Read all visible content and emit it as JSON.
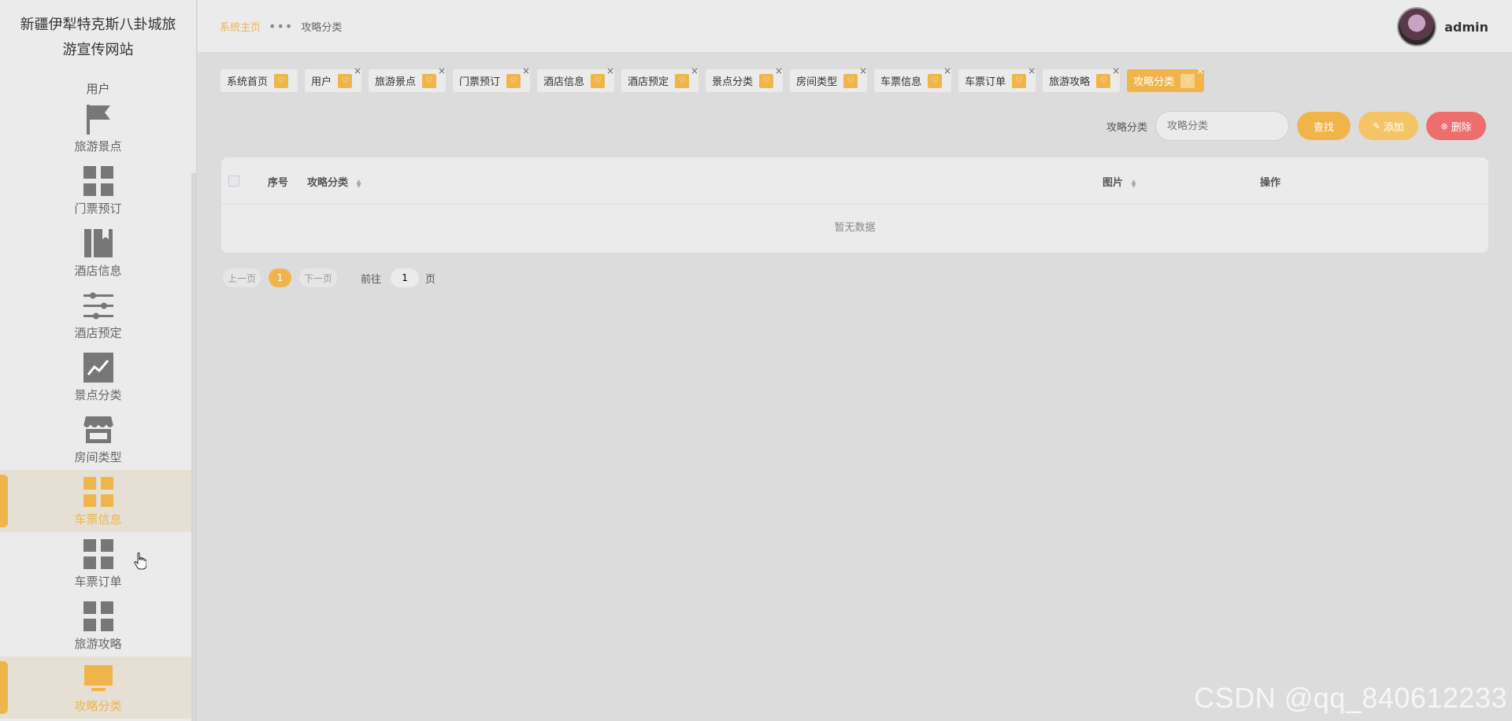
{
  "site": {
    "title": "新疆伊犁特克斯八卦城旅游宣传网站"
  },
  "sidebar": {
    "header": "用户",
    "items": [
      {
        "label": "旅游景点",
        "icon": "flag-icon",
        "active": false
      },
      {
        "label": "门票预订",
        "icon": "grid-icon",
        "active": false
      },
      {
        "label": "酒店信息",
        "icon": "book-icon",
        "active": false
      },
      {
        "label": "酒店预定",
        "icon": "sliders-icon",
        "active": false
      },
      {
        "label": "景点分类",
        "icon": "chart-icon",
        "active": false
      },
      {
        "label": "房间类型",
        "icon": "store-icon",
        "active": false
      },
      {
        "label": "车票信息",
        "icon": "grid-icon",
        "active": true
      },
      {
        "label": "车票订单",
        "icon": "grid-icon",
        "active": false
      },
      {
        "label": "旅游攻略",
        "icon": "grid-icon",
        "active": false
      },
      {
        "label": "攻略分类",
        "icon": "monitor-icon",
        "active": true
      }
    ]
  },
  "topbar": {
    "breadcrumb_home": "系统主页",
    "breadcrumb_sep": "•••",
    "breadcrumb_current": "攻略分类",
    "username": "admin"
  },
  "tabs": [
    {
      "label": "系统首页",
      "closable": false,
      "active": false
    },
    {
      "label": "用户",
      "closable": true,
      "active": false
    },
    {
      "label": "旅游景点",
      "closable": true,
      "active": false
    },
    {
      "label": "门票预订",
      "closable": true,
      "active": false
    },
    {
      "label": "酒店信息",
      "closable": true,
      "active": false
    },
    {
      "label": "酒店预定",
      "closable": true,
      "active": false
    },
    {
      "label": "景点分类",
      "closable": true,
      "active": false
    },
    {
      "label": "房间类型",
      "closable": true,
      "active": false
    },
    {
      "label": "车票信息",
      "closable": true,
      "active": false
    },
    {
      "label": "车票订单",
      "closable": true,
      "active": false
    },
    {
      "label": "旅游攻略",
      "closable": true,
      "active": false
    },
    {
      "label": "攻略分类",
      "closable": true,
      "active": true
    }
  ],
  "search": {
    "label": "攻略分类",
    "placeholder": "攻略分类",
    "find_label": "查找",
    "add_label": "添加",
    "delete_label": "删除"
  },
  "table": {
    "columns": {
      "index": "序号",
      "category": "攻略分类",
      "image": "图片",
      "actions": "操作"
    },
    "empty_text": "暂无数据"
  },
  "pagination": {
    "prev": "上一页",
    "current": "1",
    "next": "下一页",
    "goto": "前往",
    "goto_value": "1",
    "page_suffix": "页"
  },
  "watermark": "CSDN @qq_840612233",
  "colors": {
    "accent": "#f0b54a",
    "danger": "#ee6e6e"
  }
}
